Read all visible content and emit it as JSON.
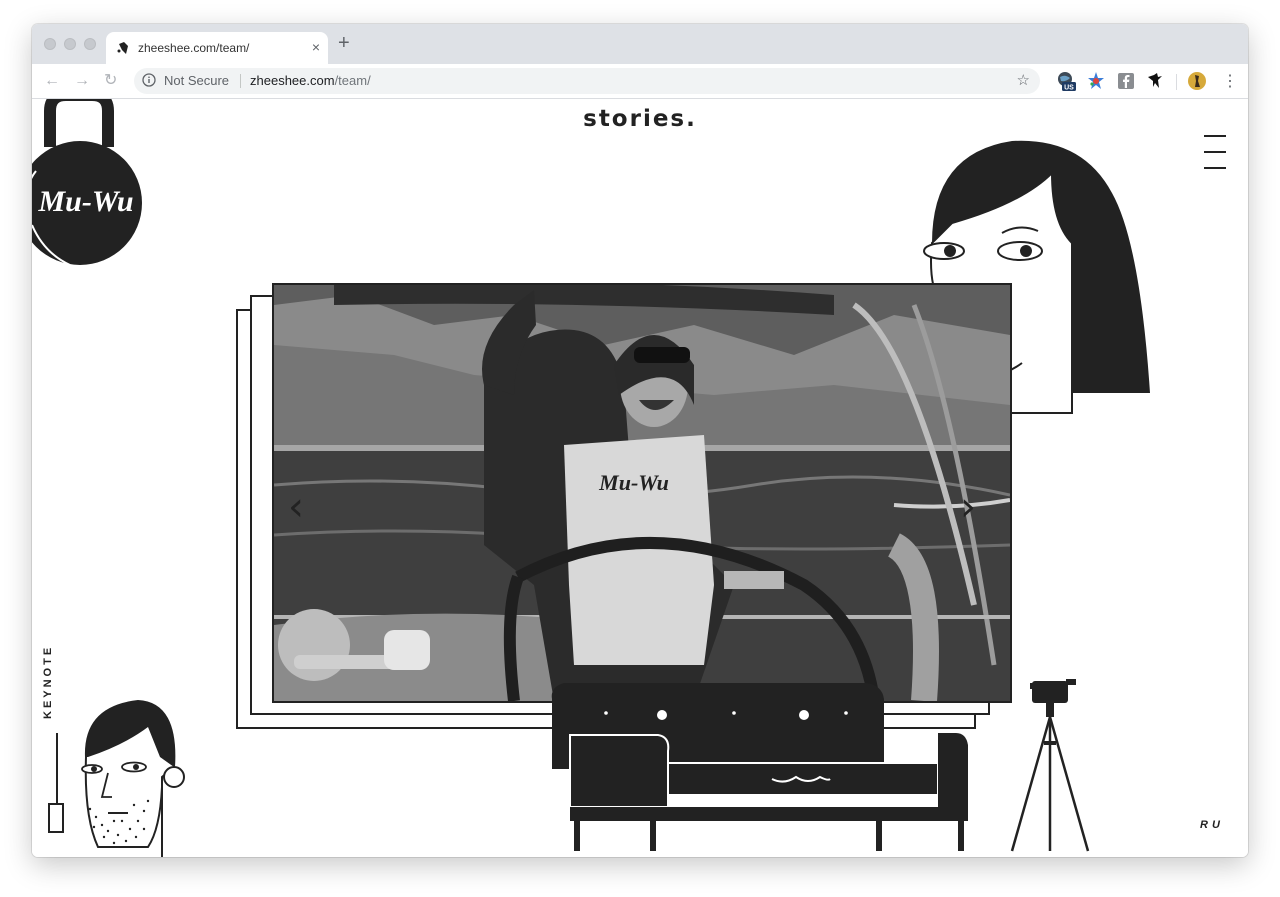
{
  "browser": {
    "tab_title": "zheeshee.com/team/",
    "tab_close": "×",
    "new_tab": "+",
    "nav_back": "←",
    "nav_forward": "→",
    "nav_reload": "↻",
    "security_label": "Not Secure",
    "url_host": "zheeshee.com",
    "url_path": "/team/",
    "bookmark_star": "☆",
    "extension_badge": "US",
    "menu": "⋮"
  },
  "page": {
    "title": "stories.",
    "logo_text": "Mu-Wu",
    "shirt_text": "Mu-Wu",
    "keynote_label": "KEYNOTE",
    "language_link": "RU",
    "prev_arrow": "‹",
    "next_arrow": "›"
  },
  "icons": {
    "menu": "hamburger-icon",
    "prev": "chevron-left-icon",
    "next": "chevron-right-icon",
    "camera": "tripod-camera-illustration"
  },
  "colors": {
    "ink": "#222222",
    "tabbar": "#dee1e6",
    "omnibox": "#f1f3f4"
  }
}
